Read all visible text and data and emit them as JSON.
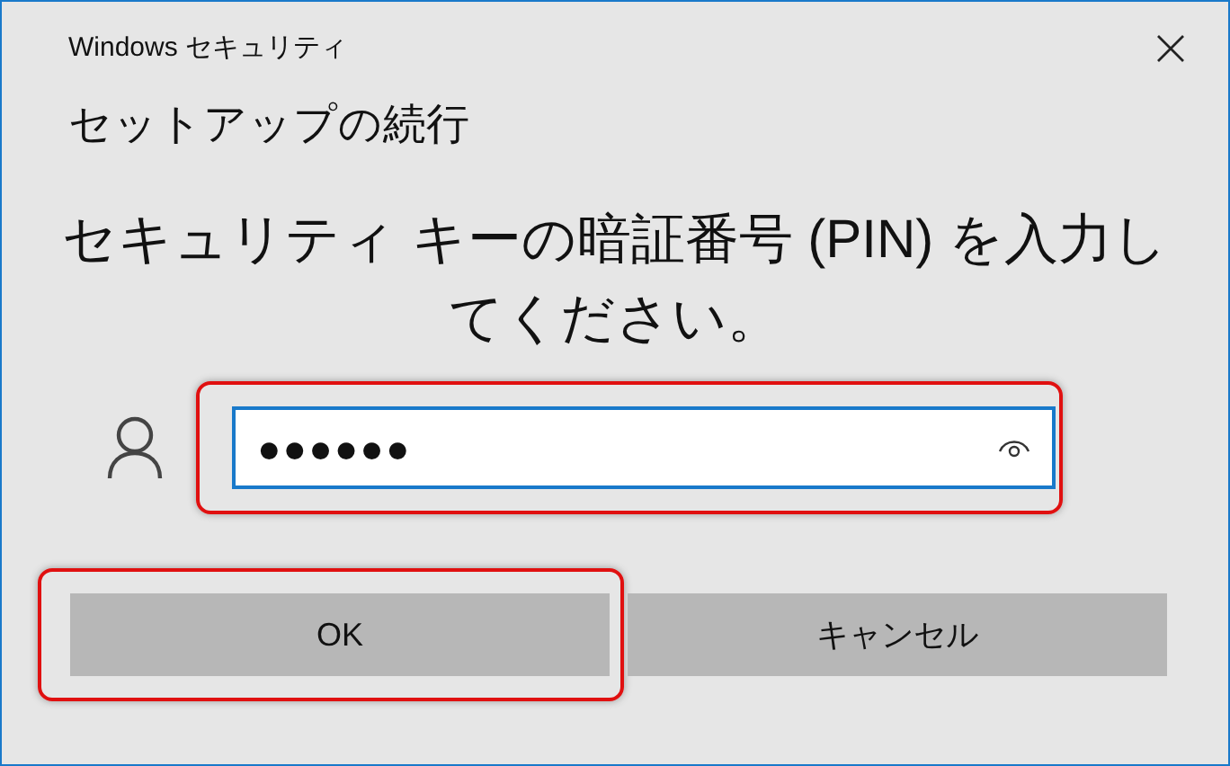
{
  "window": {
    "title": "Windows セキュリティ"
  },
  "heading": "セットアップの続行",
  "message": "セキュリティ キーの暗証番号 (PIN) を入力してください。",
  "pin_field": {
    "value": "●●●●●●",
    "highlighted": true
  },
  "buttons": [
    {
      "label": "OK",
      "highlighted": true
    },
    {
      "label": "キャンセル",
      "highlighted": false
    }
  ]
}
